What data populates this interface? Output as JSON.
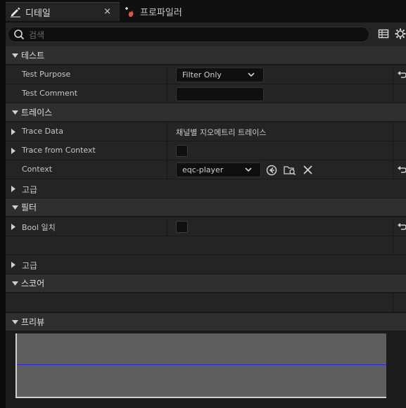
{
  "tabs": [
    {
      "label": "디테일",
      "icon": "pencil-icon",
      "active": true,
      "close": "×"
    },
    {
      "label": "프로파일러",
      "icon": "profiler-icon",
      "active": false
    }
  ],
  "search": {
    "placeholder": "검색"
  },
  "toolbar": {
    "icons": [
      "table-view-icon",
      "settings-gear-icon"
    ]
  },
  "categories": {
    "test": "테스트",
    "trace": "트레이스",
    "advanced1": "고급",
    "filter": "필터",
    "advanced2": "고급",
    "score": "스코어",
    "preview": "프리뷰"
  },
  "rows": {
    "test_purpose": {
      "label": "Test Purpose",
      "value": "Filter Only"
    },
    "test_comment": {
      "label": "Test Comment",
      "value": ""
    },
    "trace_data": {
      "label": "Trace Data",
      "value": "채널별 지오메트리 트레이스"
    },
    "trace_from_context": {
      "label": "Trace from Context",
      "checked": false
    },
    "context": {
      "label": "Context",
      "value": "eqc-player"
    },
    "bool_match": {
      "label": "Bool 일치",
      "checked": false
    }
  },
  "colors": {
    "accent_line": "#2a2ad8",
    "profiler_icon": "#e0574a"
  }
}
